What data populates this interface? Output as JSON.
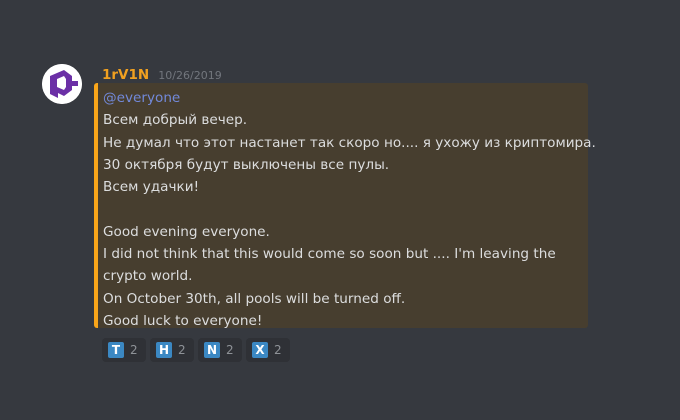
{
  "message": {
    "author": "1rV1N",
    "timestamp": "10/26/2019",
    "mention": "@everyone",
    "ru_lines": [
      "Всем добрый вечер.",
      "Не думал что этот настанет так скоро но.... я ухожу из криптомира.",
      "30 октября будут выключены все пулы.",
      "Всем удачки!"
    ],
    "en_lines": [
      "Good evening everyone.",
      "I did not think that this would come so soon but .... I'm leaving the crypto world.",
      "On October 30th, all pools will be turned off.",
      "Good luck to everyone!"
    ],
    "accent_color": "#faa61a",
    "username_color": "#f0a020"
  },
  "avatar": {
    "icon": "purple-logo-icon"
  },
  "reactions": [
    {
      "letter": "T",
      "count": "2",
      "icon": "regional-indicator-t-icon"
    },
    {
      "letter": "H",
      "count": "2",
      "icon": "regional-indicator-h-icon"
    },
    {
      "letter": "N",
      "count": "2",
      "icon": "regional-indicator-n-icon"
    },
    {
      "letter": "X",
      "count": "2",
      "icon": "regional-indicator-x-icon"
    }
  ]
}
